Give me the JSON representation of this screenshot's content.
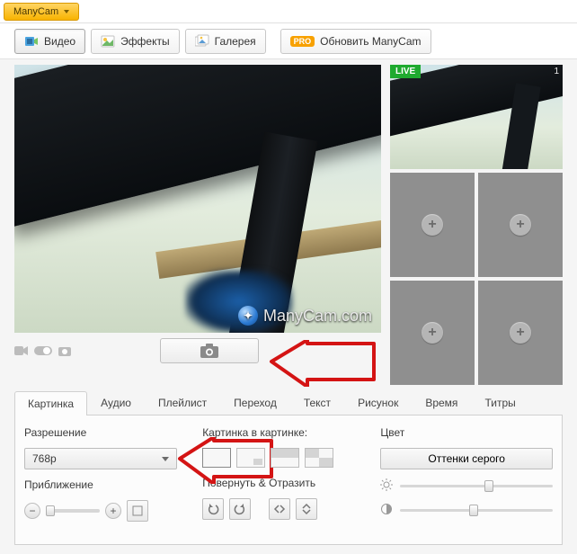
{
  "app": {
    "menu_label": "ManyCam"
  },
  "main_tabs": {
    "video": "Видео",
    "effects": "Эффекты",
    "gallery": "Галерея",
    "upgrade": "Обновить ManyCam",
    "pro_badge": "PRO"
  },
  "preview": {
    "watermark": "ManyCam.com"
  },
  "thumbs": {
    "live_badge": "LIVE",
    "live_index": "1"
  },
  "sub_tabs": [
    "Картинка",
    "Аудио",
    "Плейлист",
    "Переход",
    "Текст",
    "Рисунок",
    "Время",
    "Титры"
  ],
  "settings": {
    "resolution_label": "Разрешение",
    "resolution_value": "768p",
    "zoom_label": "Приближение",
    "pip_label": "Картинка в картинке:",
    "rotate_label": "Повернуть & Отразить",
    "color_label": "Цвет",
    "grayscale_btn": "Оттенки серого"
  }
}
